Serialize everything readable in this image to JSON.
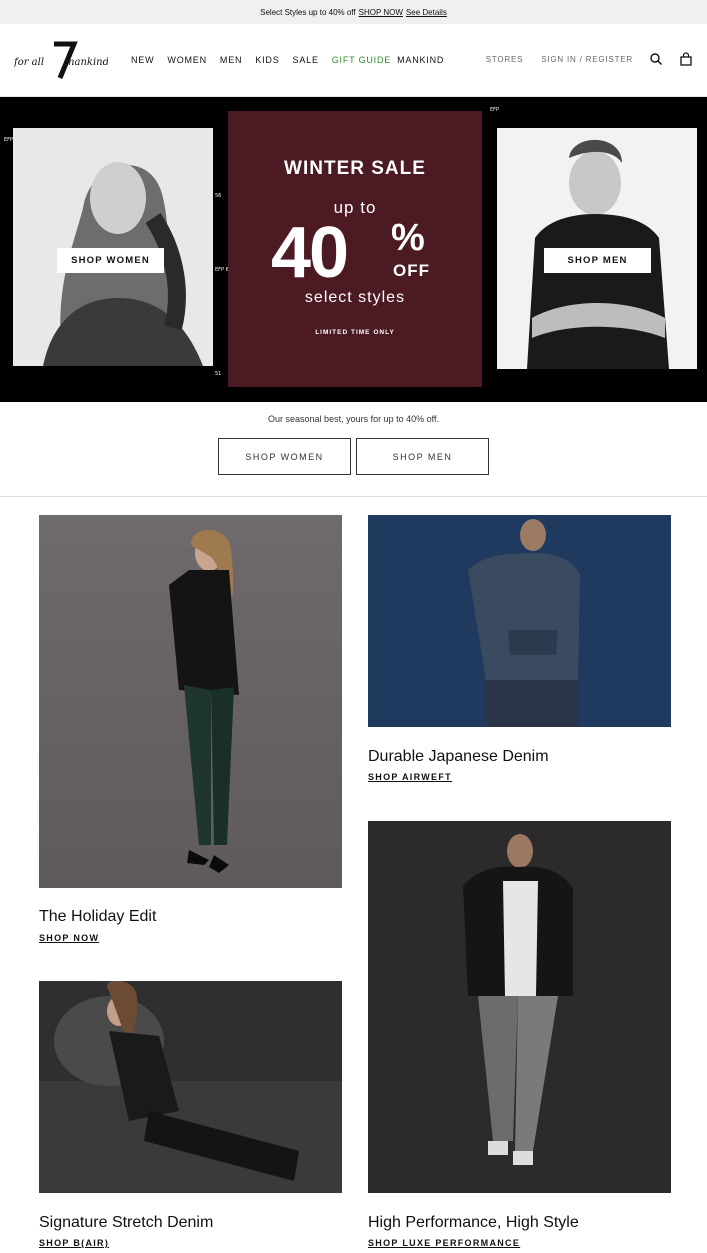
{
  "promo": {
    "text": "Select Styles up to 40% off",
    "link_shop": "SHOP NOW",
    "link_details": "See Details"
  },
  "header": {
    "logo_text": "for all 7 mankind",
    "nav": [
      "NEW",
      "WOMEN",
      "MEN",
      "KIDS",
      "SALE",
      "GIFT GUIDE",
      "MANKIND"
    ],
    "stores": "STORES",
    "signin": "SIGN IN / REGISTER",
    "icons": [
      "search-icon",
      "bag-icon"
    ],
    "gift_color": "#2f8e2f"
  },
  "hero": {
    "title": "WINTER SALE",
    "upto": "up to",
    "number": "40",
    "percent": "%",
    "off": "OFF",
    "select": "select styles",
    "limited": "LIMITED TIME ONLY",
    "shop_women": "SHOP WOMEN",
    "shop_men": "SHOP MEN",
    "panel_color": "#4b1a22",
    "film_marks": [
      "EFP",
      "56",
      "EFP 6605",
      "51",
      "EFP"
    ]
  },
  "intro": {
    "tagline": "Our seasonal best, yours for up to 40% off.",
    "btn_women": "SHOP WOMEN",
    "btn_men": "SHOP MEN"
  },
  "tiles": [
    {
      "title": "The Holiday Edit",
      "link": "SHOP NOW"
    },
    {
      "title": "Durable Japanese Denim",
      "link": "SHOP AIRWEFT"
    },
    {
      "title": "Signature Stretch Denim",
      "link": "SHOP B(AIR)"
    },
    {
      "title": "High Performance, High Style",
      "link": "SHOP LUXE PERFORMANCE"
    }
  ]
}
